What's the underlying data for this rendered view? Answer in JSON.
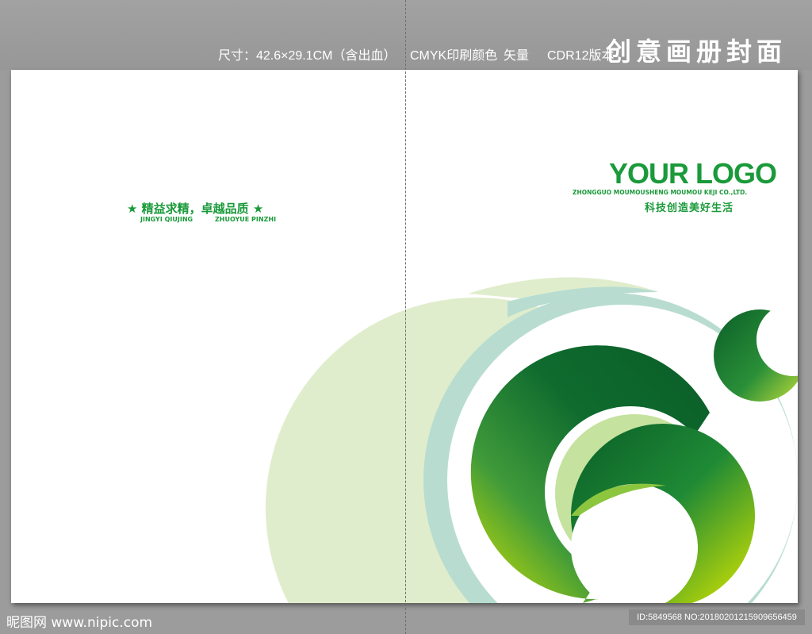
{
  "header": {
    "spec_size": "尺寸：42.6×29.1CM（含出血）",
    "spec_color": "CMYK印刷颜色",
    "spec_vector": "矢量",
    "spec_version": "CDR12版本",
    "title": "创意画册封面"
  },
  "cover": {
    "slogan": "★ 精益求精，卓越品质 ★",
    "slogan_pinyin_1": "JINGYI QIUJING",
    "slogan_pinyin_2": "ZHUOYUE PINZHI",
    "logo": "YOUR LOGO",
    "company": "ZHONGGUO MOUMOUSHENG MOUMOU KEJI CO.,LTD.",
    "tagline": "科技创造美好生活"
  },
  "footer": {
    "watermark": "昵图网 www.nipic.com",
    "id_text": "ID:5849568 NO:20180201215909656459"
  },
  "colors": {
    "brand_green": "#1a9a3a",
    "dark_green": "#0f6b2e",
    "light_green": "#e0edcc",
    "teal": "#b8ddd0"
  }
}
